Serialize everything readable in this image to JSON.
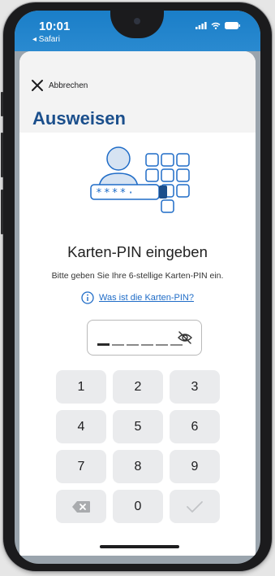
{
  "status_bar": {
    "time": "10:01",
    "back_app": "◂ Safari",
    "icons": [
      "signal-icon",
      "wifi-icon",
      "battery-icon"
    ]
  },
  "header": {
    "close_label": "Abbrechen",
    "title": "Ausweisen"
  },
  "illustration": {
    "masked_pin": "****·"
  },
  "content": {
    "heading": "Karten-PIN eingeben",
    "subtitle": "Bitte geben Sie Ihre 6-stellige Karten-PIN ein.",
    "info_link": "Was ist die Karten-PIN?"
  },
  "pin_field": {
    "length": 6,
    "filled": 0
  },
  "keypad": {
    "keys": [
      "1",
      "2",
      "3",
      "4",
      "5",
      "6",
      "7",
      "8",
      "9",
      "0"
    ]
  },
  "colors": {
    "primary_blue": "#1b4f8c",
    "link_blue": "#1f6cc7",
    "status_bar_blue": "#1a7ec8",
    "key_bg": "#eaebed"
  }
}
